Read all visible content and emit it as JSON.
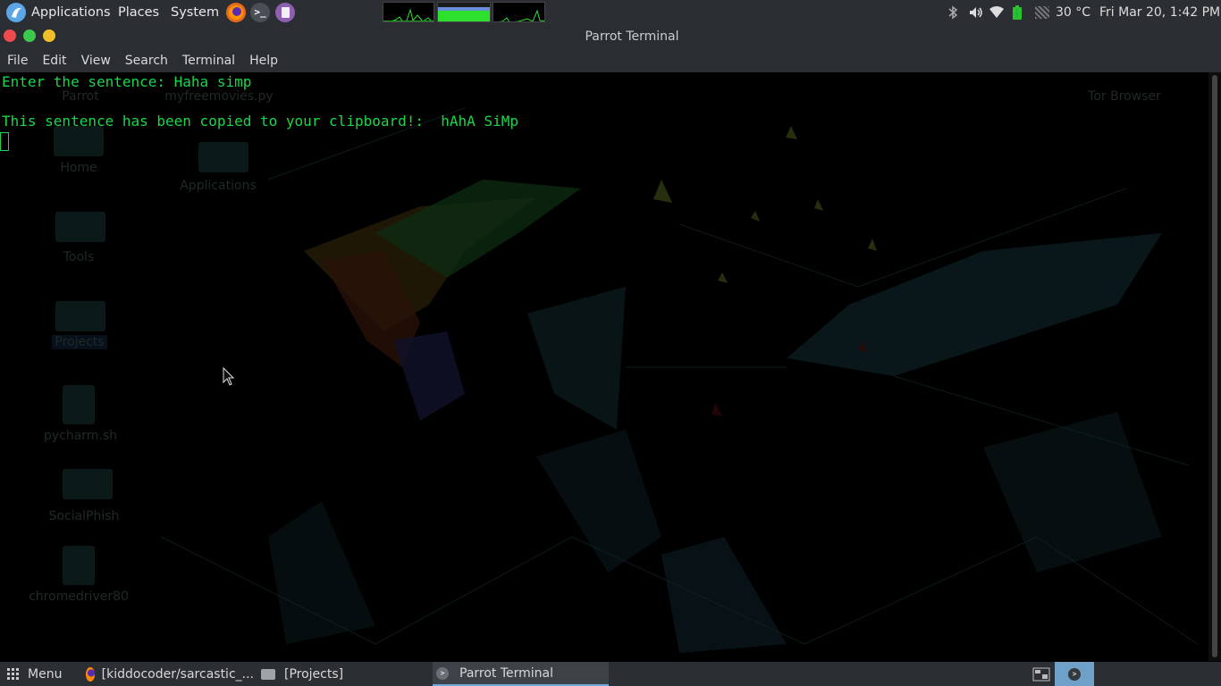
{
  "top_panel": {
    "menus": [
      "Applications",
      "Places",
      "System"
    ],
    "launchers": [
      "firefox-icon",
      "terminal-icon",
      "text-editor-icon"
    ],
    "temperature": "30 °C",
    "datetime": "Fri Mar 20,  1:42 PM"
  },
  "window": {
    "title": "Parrot Terminal",
    "menu": [
      "File",
      "Edit",
      "View",
      "Search",
      "Terminal",
      "Help"
    ]
  },
  "terminal": {
    "lines": [
      "Enter the sentence: Haha simp",
      "",
      "This sentence has been copied to your clipboard!:  hAhA SiMp"
    ],
    "text_color": "#1ad64a"
  },
  "desktop_icons": [
    {
      "label": "Parrot"
    },
    {
      "label": "myfreemovies.py"
    },
    {
      "label": "Tor Browser"
    },
    {
      "label": "Home"
    },
    {
      "label": "Applications"
    },
    {
      "label": "Tools"
    },
    {
      "label": "Projects"
    },
    {
      "label": "pycharm.sh"
    },
    {
      "label": "SocialPhish"
    },
    {
      "label": "chromedriver80"
    }
  ],
  "taskbar": {
    "menu_label": "Menu",
    "tasks": [
      "[kiddocoder/sarcastic_...",
      "[Projects]",
      "Parrot Terminal"
    ]
  }
}
